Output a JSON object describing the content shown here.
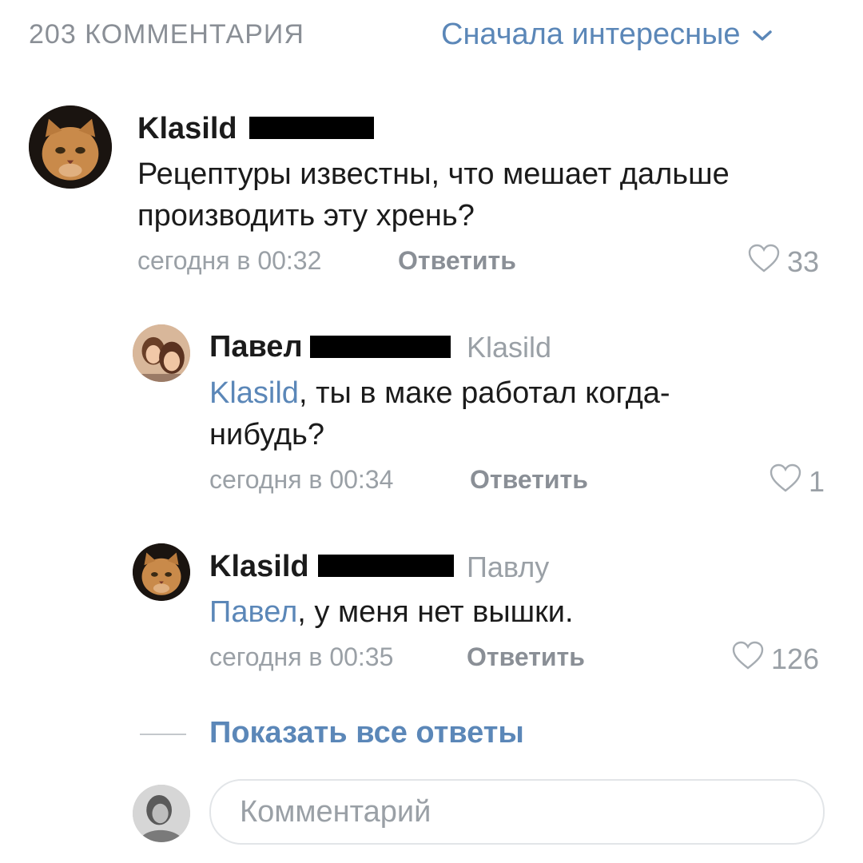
{
  "header": {
    "comments_count": "203 КОММЕНТАРИЯ",
    "sort_label": "Сначала интересные"
  },
  "comments": [
    {
      "author": "Klasild",
      "text": "Рецептуры известны, что мешает дальше производить эту хрень?",
      "time": "сегодня в 00:32",
      "reply_label": "Ответить",
      "likes": "33"
    },
    {
      "author": "Павел",
      "reply_to": "Klasild",
      "mention": "Klasild",
      "text": ", ты в маке работал когда-нибудь?",
      "time": "сегодня в 00:34",
      "reply_label": "Ответить",
      "likes": "1"
    },
    {
      "author": "Klasild",
      "reply_to": "Павлу",
      "mention": "Павел",
      "text": ", у меня нет вышки.",
      "time": "сегодня в 00:35",
      "reply_label": "Ответить",
      "likes": "126"
    }
  ],
  "show_all_replies": "Показать все ответы",
  "comment_input": {
    "placeholder": "Комментарий"
  },
  "colors": {
    "link": "#5b87b8",
    "muted": "#9aa0a6",
    "redaction": "#000000"
  }
}
